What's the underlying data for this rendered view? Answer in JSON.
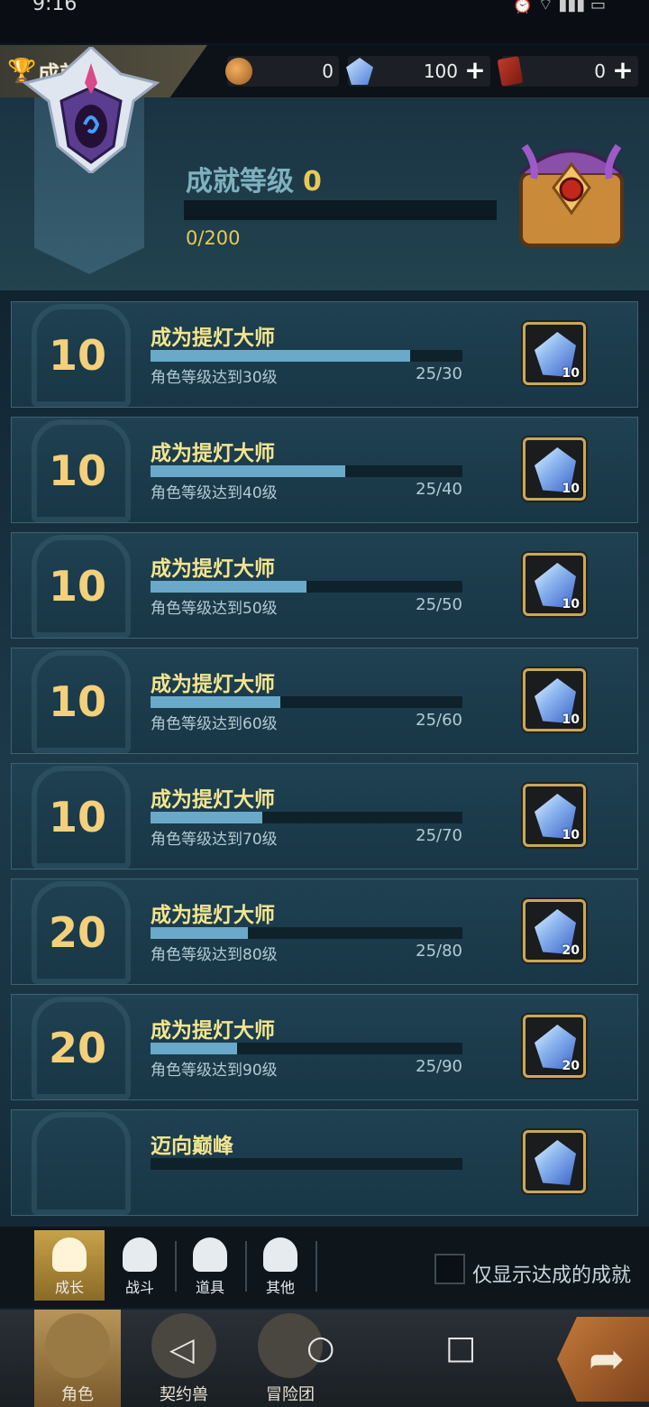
{
  "status": {
    "time": "9:16",
    "icons": "⏰ ⌔ ▮▮▮ ▭"
  },
  "header": {
    "title": "成就",
    "info_icon": "!",
    "currencies": [
      {
        "icon": "coin-icon",
        "value": "0",
        "has_plus": false
      },
      {
        "icon": "crystal-icon",
        "value": "100",
        "has_plus": true
      },
      {
        "icon": "ticket-icon",
        "value": "0",
        "has_plus": true
      }
    ]
  },
  "summary": {
    "level_label": "成就等级",
    "level": "0",
    "progress": "0/200",
    "progress_fraction": 0
  },
  "achievements": [
    {
      "points": "10",
      "name": "成为提灯大师",
      "desc": "角色等级达到30级",
      "count": "25/30",
      "progress": 0.833,
      "reward_qty": "10"
    },
    {
      "points": "10",
      "name": "成为提灯大师",
      "desc": "角色等级达到40级",
      "count": "25/40",
      "progress": 0.625,
      "reward_qty": "10"
    },
    {
      "points": "10",
      "name": "成为提灯大师",
      "desc": "角色等级达到50级",
      "count": "25/50",
      "progress": 0.5,
      "reward_qty": "10"
    },
    {
      "points": "10",
      "name": "成为提灯大师",
      "desc": "角色等级达到60级",
      "count": "25/60",
      "progress": 0.417,
      "reward_qty": "10"
    },
    {
      "points": "10",
      "name": "成为提灯大师",
      "desc": "角色等级达到70级",
      "count": "25/70",
      "progress": 0.357,
      "reward_qty": "10"
    },
    {
      "points": "20",
      "name": "成为提灯大师",
      "desc": "角色等级达到80级",
      "count": "25/80",
      "progress": 0.313,
      "reward_qty": "20"
    },
    {
      "points": "20",
      "name": "成为提灯大师",
      "desc": "角色等级达到90级",
      "count": "25/90",
      "progress": 0.278,
      "reward_qty": "20"
    },
    {
      "points": "",
      "name": "迈向巅峰",
      "desc": "",
      "count": "",
      "progress": 0,
      "reward_qty": ""
    }
  ],
  "category_tabs": [
    {
      "label": "成长",
      "icon": "growth-icon",
      "active": true
    },
    {
      "label": "战斗",
      "icon": "battle-icon",
      "active": false
    },
    {
      "label": "道具",
      "icon": "item-icon",
      "active": false
    },
    {
      "label": "其他",
      "icon": "other-icon",
      "active": false
    }
  ],
  "filter": {
    "label": "仅显示达成的成就",
    "checked": false
  },
  "nav": [
    {
      "label": "角色",
      "icon": "character-icon",
      "active": true
    },
    {
      "label": "契约兽",
      "icon": "pet-icon",
      "active": false
    },
    {
      "label": "冒险团",
      "icon": "guild-icon",
      "active": false
    }
  ],
  "system_nav": {
    "back": "◁",
    "home": "○",
    "recents": "□"
  },
  "go_button": "➦"
}
